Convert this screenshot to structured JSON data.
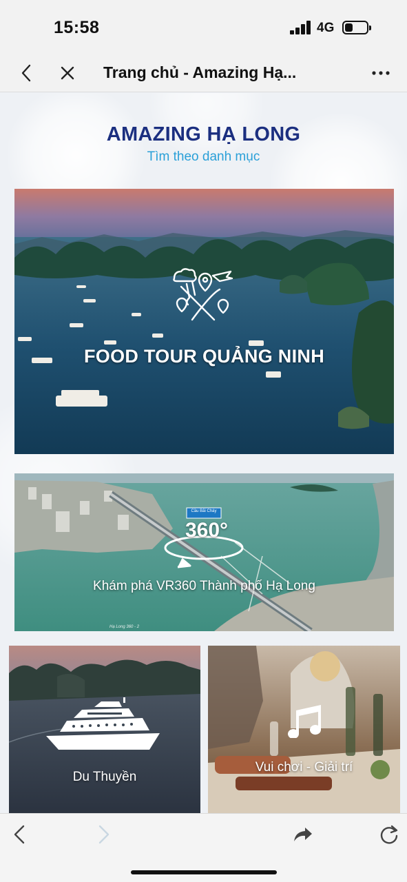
{
  "status_bar": {
    "time": "15:58",
    "network": "4G",
    "battery_level": 0.35
  },
  "browser": {
    "title": "Trang chủ - Amazing Hạ..."
  },
  "header": {
    "title": "AMAZING HẠ LONG",
    "subtitle": "Tìm theo danh mục"
  },
  "cards": {
    "food_tour": {
      "label": "FOOD TOUR QUẢNG NINH"
    },
    "vr360": {
      "label": "Khám phá VR360 Thành phố Hạ Long",
      "badge": "360°",
      "bridge_tag": "Cầu Bãi Cháy",
      "caption": "Hạ Long 360 - 2"
    },
    "cruise": {
      "label": "Du Thuyền"
    },
    "entertainment": {
      "label": "Vui chơi - Giải trí"
    }
  },
  "icons": {
    "back": "chevron-left-icon",
    "close": "close-icon",
    "more": "more-icon",
    "food": "food-tour-icon",
    "vr": "vr360-icon",
    "cruise": "cruise-ship-icon",
    "music": "music-note-icon",
    "nav_back": "back-arrow-icon",
    "nav_forward": "forward-arrow-icon",
    "share": "share-icon",
    "reload": "reload-icon"
  },
  "colors": {
    "title": "#1b2f80",
    "subtitle": "#2aa0d8"
  }
}
